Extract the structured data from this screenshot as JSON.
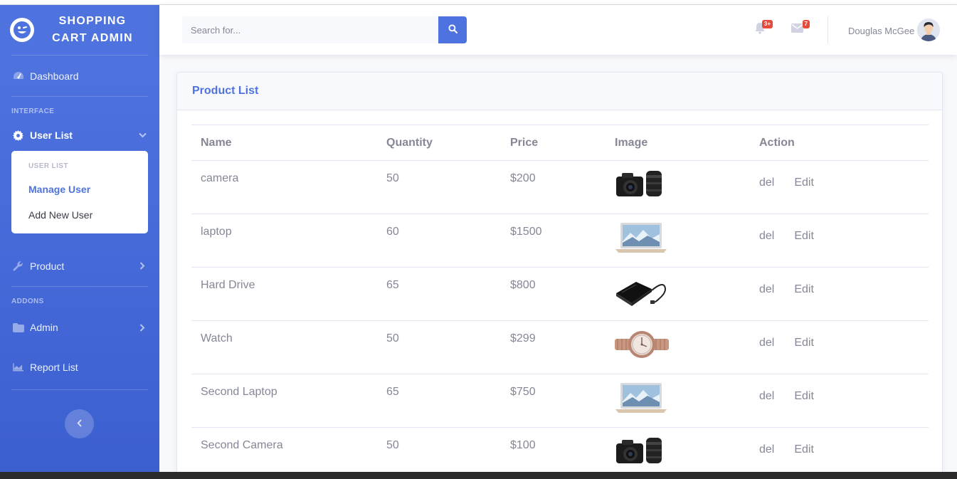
{
  "brand": {
    "title": "Shopping Cart Admin"
  },
  "sidebar": {
    "dashboard": "Dashboard",
    "interface_heading": "INTERFACE",
    "user_list": "User List",
    "submenu": {
      "heading": "USER LIST",
      "items": [
        "Manage User",
        "Add New User"
      ]
    },
    "product": "Product",
    "addons_heading": "ADDONS",
    "admin": "Admin",
    "report_list": "Report List"
  },
  "topbar": {
    "search_placeholder": "Search for...",
    "alerts_badge": "3+",
    "messages_badge": "7",
    "user_name": "Douglas McGee"
  },
  "card": {
    "title": "Product List"
  },
  "table": {
    "headers": [
      "Name",
      "Quantity",
      "Price",
      "Image",
      "Action"
    ],
    "rows": [
      {
        "name": "camera",
        "quantity": "50",
        "price": "$200",
        "image": "camera-image"
      },
      {
        "name": "laptop",
        "quantity": "60",
        "price": "$1500",
        "image": "laptop-image"
      },
      {
        "name": "Hard Drive",
        "quantity": "65",
        "price": "$800",
        "image": "hard-drive-image"
      },
      {
        "name": "Watch",
        "quantity": "50",
        "price": "$299",
        "image": "watch-image"
      },
      {
        "name": "Second Laptop",
        "quantity": "65",
        "price": "$750",
        "image": "laptop-image"
      },
      {
        "name": "Second Camera",
        "quantity": "50",
        "price": "$100",
        "image": "camera-image"
      }
    ],
    "actions": {
      "delete": "del",
      "edit": "Edit"
    }
  },
  "colors": {
    "primary": "#4e73df",
    "text": "#858796",
    "danger": "#e74a3b"
  }
}
